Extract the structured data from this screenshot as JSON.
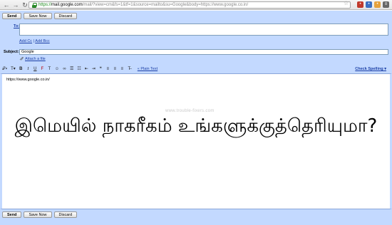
{
  "browser": {
    "url_scheme": "https://",
    "url_host": "mail.google.com",
    "url_rest": "/mail/?view=cm&fs=1&tf=1&source=mailto&su=Google&body=https://www.google.co.in/",
    "back_icon": "back-arrow-icon",
    "forward_icon": "forward-arrow-icon",
    "reload_icon": "reload-icon"
  },
  "compose": {
    "top_buttons": {
      "send": "Send",
      "save_now": "Save Now",
      "discard": "Discard"
    },
    "to_label": "To:",
    "to_value": "",
    "add_cc": "Add Cc",
    "separator": " | ",
    "add_bcc": "Add Bcc",
    "subject_label": "Subject:",
    "subject_value": "Google",
    "attach_file": "Attach a file",
    "plain_text": "« Plain Text",
    "check_spelling": "Check Spelling ▾",
    "body_text": "https://www.google.co.in/",
    "watermark": "www.trouble-fixers.com",
    "caption": "இமெயில் நாகரீகம் உங்களுக்குத்தெரியுமா?",
    "bottom_buttons": {
      "send": "Send",
      "save_now": "Save Now",
      "discard": "Discard"
    }
  },
  "colors": {
    "panel": "#c3d9ff",
    "link": "#1a3ea5"
  }
}
